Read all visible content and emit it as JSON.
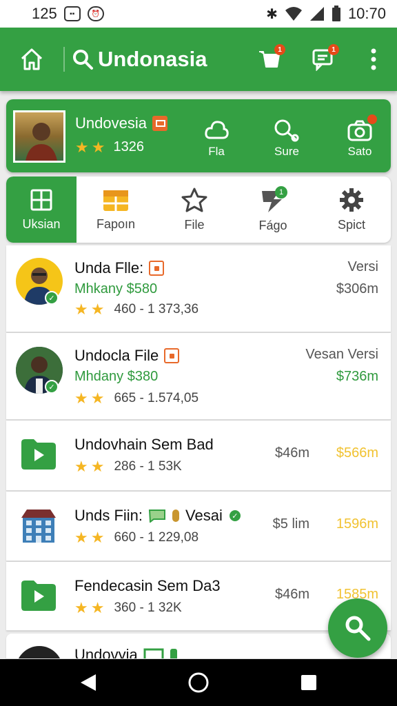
{
  "status_bar": {
    "time_left": "125",
    "time_right": "10:70"
  },
  "app_bar": {
    "title": "Undonasia",
    "cart_badge": "1",
    "messages_badge": "1"
  },
  "profile": {
    "name": "Undovesia",
    "rating": "1326",
    "actions": [
      {
        "label": "Fla",
        "icon": "cloud-icon"
      },
      {
        "label": "Sure",
        "icon": "key-icon"
      },
      {
        "label": "Sato",
        "icon": "camera-icon"
      }
    ]
  },
  "tabs": [
    {
      "label": "Uksian",
      "icon": "grid-icon",
      "active": true
    },
    {
      "label": "Fapoın",
      "icon": "calendar-icon"
    },
    {
      "label": "File",
      "icon": "star-icon"
    },
    {
      "label": "Fágo",
      "icon": "lightning-icon",
      "badge": "1"
    },
    {
      "label": "Spict",
      "icon": "gear-icon"
    }
  ],
  "rows": [
    {
      "title": "Unda Flle:",
      "subtitle": "Mhkany $580",
      "stats": "460 - 1 373,36",
      "right1": "Versi",
      "right2": "$306m",
      "right2_color": "#555555"
    },
    {
      "title": "Undocla File",
      "subtitle": "Mhdany $380",
      "stats": "665 - 1.574,05",
      "right1": "Vesan Versi",
      "right2": "$736m",
      "right2_color": "#2f9a3d"
    },
    {
      "title": "Undovhain Sem Bad",
      "stats": "286 - 1 53K",
      "right1": "$46m",
      "right2": "$566m",
      "right2_color": "#f1c230"
    },
    {
      "title": "Unds Fiin:",
      "title_suffix": "Vesai",
      "stats": "660 - 1 229,08",
      "right1": "$5 lim",
      "right2": "1596m",
      "right2_color": "#f1c230"
    },
    {
      "title": "Fendecasin Sem Da3",
      "stats": "360 - 1 32K",
      "right1": "$46m",
      "right2": "1585m",
      "right2_color": "#f1c230"
    },
    {
      "title": "Undovyia"
    }
  ],
  "colors": {
    "primary": "#34a043",
    "accent_orange": "#e8692a",
    "gold": "#f1c230"
  }
}
